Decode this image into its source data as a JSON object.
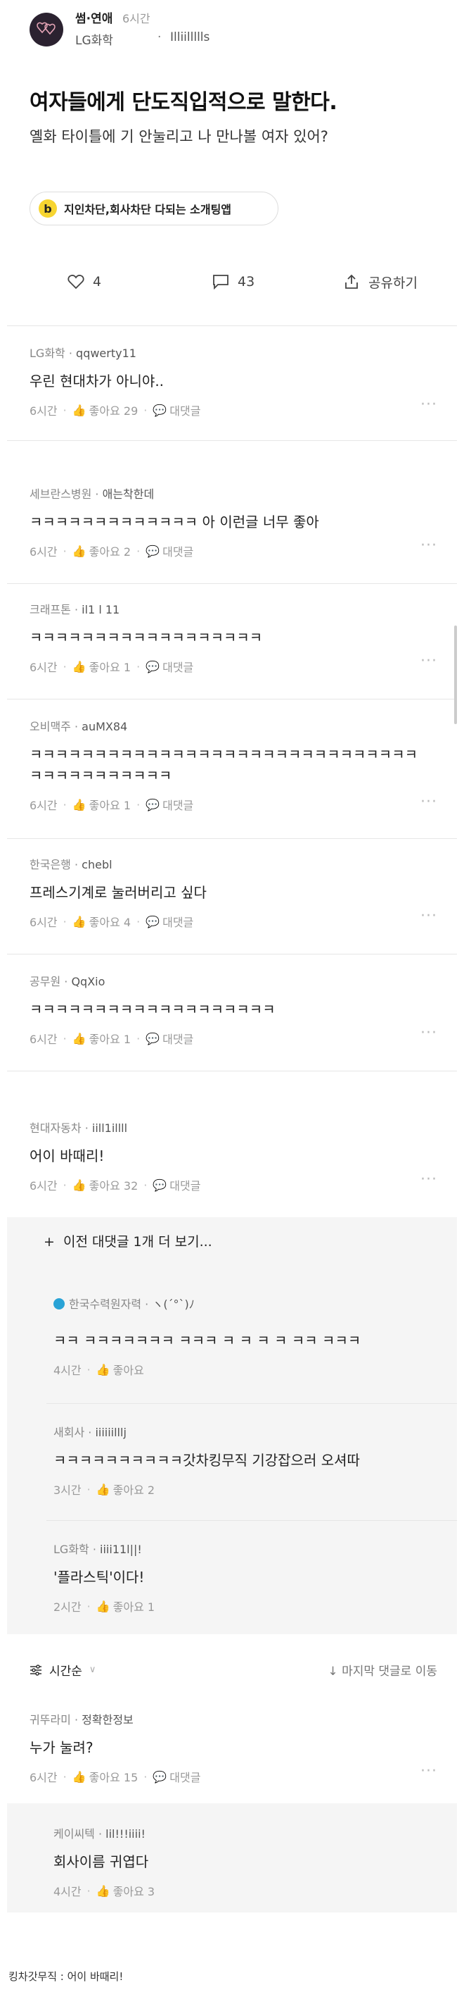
{
  "post": {
    "category": "썸·연애",
    "time": "6시간",
    "company": "LG화학",
    "nickname": "Illiillllls",
    "title": "여자들에게 단도직입적으로 말한다.",
    "body": "옐화 타이틀에 기 안눌리고 나 만나볼 여자 있어?"
  },
  "ad": {
    "icon_letter": "b",
    "text": "지인차단,회사차단 다되는 소개팅앱"
  },
  "actions": {
    "likes": "4",
    "comments": "43",
    "share_label": "공유하기"
  },
  "labels": {
    "like": "좋아요",
    "reply": "대댓글",
    "more_dots": "···"
  },
  "comments": [
    {
      "company": "LG화학",
      "nick": "qqwerty11",
      "text": "우린 현대차가 아니야..",
      "time": "6시간",
      "likes": "좋아요 29"
    },
    {
      "company": "세브란스병원",
      "nick": "애는착한데",
      "text": "ㅋㅋㅋㅋㅋㅋㅋㅋㅋㅋㅋㅋㅋ 아 이런글 너무 좋아",
      "time": "6시간",
      "likes": "좋아요 2"
    },
    {
      "company": "크래프톤",
      "nick": "il1 l 11",
      "text": "ㅋㅋㅋㅋㅋㅋㅋㅋㅋㅋㅋㅋㅋㅋㅋㅋㅋㅋ",
      "time": "6시간",
      "likes": "좋아요 1"
    },
    {
      "company": "오비맥주",
      "nick": "auMX84",
      "text": "ㅋㅋㅋㅋㅋㅋㅋㅋㅋㅋㅋㅋㅋㅋㅋㅋㅋㅋㅋㅋㅋㅋㅋㅋㅋㅋㅋㅋㅋㅋㅋㅋㅋㅋㅋㅋㅋㅋㅋㅋㅋ",
      "time": "6시간",
      "likes": "좋아요 1"
    },
    {
      "company": "한국은행",
      "nick": "chebl",
      "text": "프레스기계로 눌러버리고 싶다",
      "time": "6시간",
      "likes": "좋아요 4"
    },
    {
      "company": "공무원",
      "nick": "QqXio",
      "text": "ㅋㅋㅋㅋㅋㅋㅋㅋㅋㅋㅋㅋㅋㅋㅋㅋㅋㅋㅋ",
      "time": "6시간",
      "likes": "좋아요 1"
    },
    {
      "company": "현대자동차",
      "nick": "iill1illll",
      "text": "어이 바때리!",
      "time": "6시간",
      "likes": "좋아요 32"
    }
  ],
  "more_replies": "이전 대댓글 1개 더 보기...",
  "replies": [
    {
      "company": "한국수력원자력",
      "nick": "ヽ(´°`)ﾉ",
      "text": "ㅋㅋ ㅋㅋㅋㅋㅋㅋㅋ ㅋㅋㅋ ㅋ ㅋ ㅋ ㅋ ㅋㅋ ㅋㅋㅋ",
      "time": "4시간",
      "likes": "좋아요"
    },
    {
      "company": "새회사",
      "nick": "iiiiiilllj",
      "text": "ㅋㅋㅋㅋㅋㅋㅋㅋㅋㅋ갓차킹무직 기강잡으러 오셔따",
      "time": "3시간",
      "likes": "좋아요 2"
    },
    {
      "company": "LG화학",
      "nick": "iiii11l||!",
      "text": "'플라스틱'이다!",
      "time": "2시간",
      "likes": "좋아요 1"
    }
  ],
  "sort": {
    "label": "시간순",
    "jump": "마지막 댓글로 이동"
  },
  "last_comment": {
    "company": "귀뚜라미",
    "nick": "정확한정보",
    "text": "누가 눌려?",
    "time": "6시간",
    "likes": "좋아요 15"
  },
  "last_reply": {
    "company": "케이씨텍",
    "nick": "lil!!!iiii!",
    "text": "회사이름 귀엽다",
    "time": "4시간",
    "likes": "좋아요 3"
  },
  "footer": "킹차갓무직 : 어이 바때리!",
  "colors": {
    "ad_yellow": "#f7d531",
    "reply_bg": "#f5f5f5"
  }
}
